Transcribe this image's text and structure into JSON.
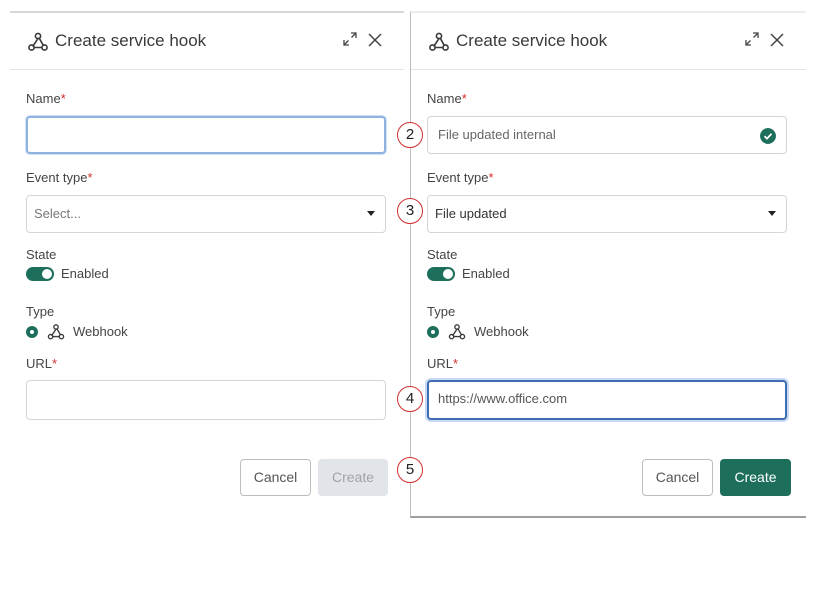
{
  "left_dialog": {
    "title": "Create service hook",
    "name_label": "Name",
    "name_value": "",
    "event_type_label": "Event type",
    "event_type_placeholder": "Select...",
    "state_label": "State",
    "state_toggle_label": "Enabled",
    "state_enabled": true,
    "type_label": "Type",
    "type_option_label": "Webhook",
    "url_label": "URL",
    "url_value": "",
    "cancel_label": "Cancel",
    "create_label": "Create",
    "create_disabled": true
  },
  "right_dialog": {
    "title": "Create service hook",
    "name_label": "Name",
    "name_value": "File updated internal",
    "event_type_label": "Event type",
    "event_type_value": "File updated",
    "state_label": "State",
    "state_toggle_label": "Enabled",
    "state_enabled": true,
    "type_label": "Type",
    "type_option_label": "Webhook",
    "url_label": "URL",
    "url_value": "https://www.office.com",
    "cancel_label": "Cancel",
    "create_label": "Create",
    "create_disabled": false
  },
  "required_marker": "*",
  "step_markers": [
    "2",
    "3",
    "4",
    "5"
  ],
  "colors": {
    "accent": "#1d6f5c",
    "required": "#d32f2f",
    "step_ring": "#d32f2f",
    "disabled_button": "#e1e4e8"
  },
  "icons": {
    "header_icon": "webhook-icon",
    "expand": "expand-icon",
    "close": "close-icon",
    "valid": "check-circle-icon",
    "dropdown": "chevron-down-icon"
  }
}
